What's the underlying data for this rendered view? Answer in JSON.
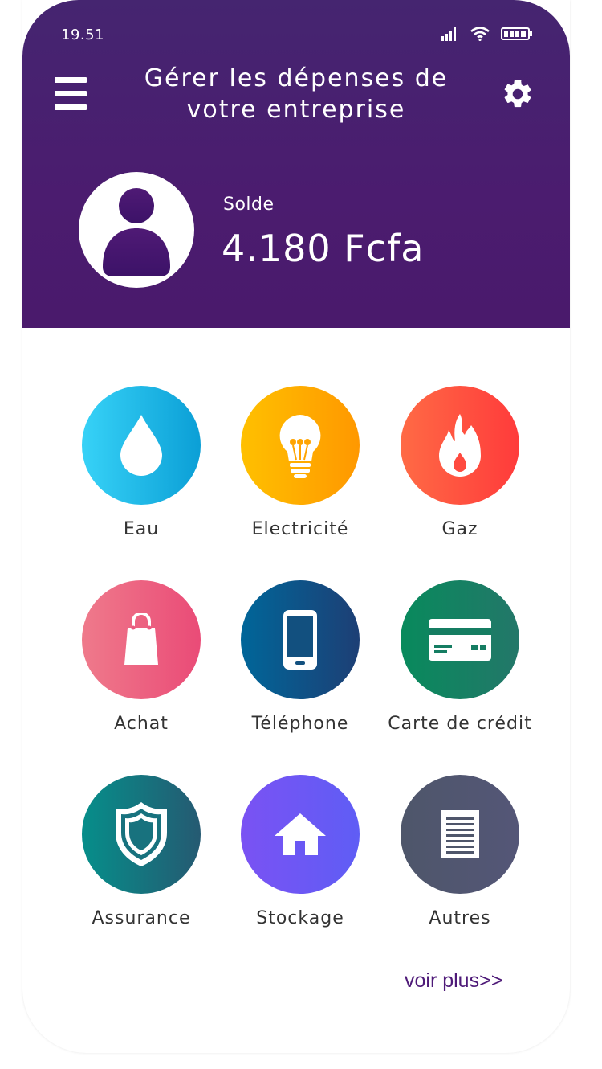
{
  "status_bar": {
    "time": "19.51"
  },
  "header": {
    "title": "Gérer les dépenses de votre entreprise",
    "balance_label": "Solde",
    "balance_value": "4.180 Fcfa"
  },
  "categories": [
    {
      "label": "Eau",
      "icon": "water-drop-icon",
      "colors": [
        "#37d2f7",
        "#0b9fd6"
      ]
    },
    {
      "label": "Electricité",
      "icon": "light-bulb-icon",
      "colors": [
        "#ffc000",
        "#ff9800"
      ]
    },
    {
      "label": "Gaz",
      "icon": "flame-icon",
      "colors": [
        "#ff6a45",
        "#ff3b3b"
      ]
    },
    {
      "label": "Achat",
      "icon": "shopping-bag-icon",
      "colors": [
        "#ef7a8b",
        "#ea4b77"
      ]
    },
    {
      "label": "Téléphone",
      "icon": "phone-icon",
      "colors": [
        "#006699",
        "#1d3f75"
      ]
    },
    {
      "label": "Carte de crédit",
      "icon": "credit-card-icon",
      "colors": [
        "#088a5c",
        "#237769"
      ]
    },
    {
      "label": "Assurance",
      "icon": "shield-icon",
      "colors": [
        "#068e8a",
        "#255a72"
      ]
    },
    {
      "label": "Stockage",
      "icon": "house-icon",
      "colors": [
        "#7a52f3",
        "#5f5df5"
      ]
    },
    {
      "label": "Autres",
      "icon": "document-icon",
      "colors": [
        "#4e566a",
        "#545677"
      ]
    }
  ],
  "more_link": "voir plus>>"
}
